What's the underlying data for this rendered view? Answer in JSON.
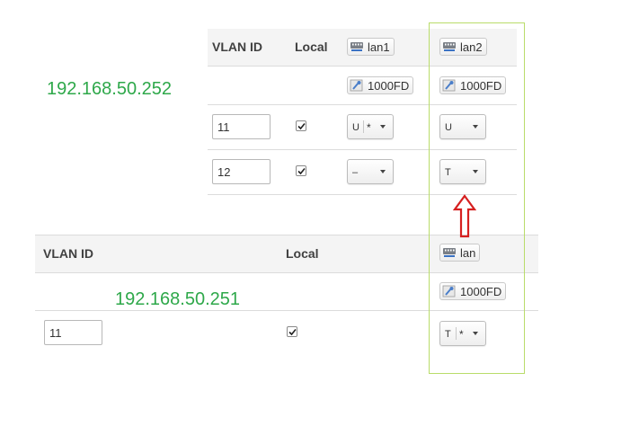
{
  "top_table": {
    "ip": "192.168.50.252",
    "header": {
      "vlan_id": "VLAN ID",
      "local": "Local"
    },
    "ports": [
      {
        "name": "lan1",
        "speed": "1000FD"
      },
      {
        "name": "lan2",
        "speed": "1000FD"
      }
    ],
    "rows": [
      {
        "vlan_id": "11",
        "local_checked": true,
        "lan1": {
          "mode": "U",
          "extra": "*"
        },
        "lan2": {
          "mode": "U",
          "extra": ""
        }
      },
      {
        "vlan_id": "12",
        "local_checked": true,
        "lan1": {
          "mode": "–",
          "extra": ""
        },
        "lan2": {
          "mode": "T",
          "extra": ""
        }
      }
    ]
  },
  "bottom_table": {
    "ip": "192.168.50.251",
    "header": {
      "vlan_id": "VLAN ID",
      "local": "Local"
    },
    "ports": [
      {
        "name": "lan",
        "speed": "1000FD"
      }
    ],
    "rows": [
      {
        "vlan_id": "11",
        "local_checked": true,
        "lan": {
          "mode": "T",
          "extra": "*"
        }
      }
    ]
  },
  "annotation": {
    "highlight_color": "#b9dc6a",
    "arrow_color": "#d62020",
    "ip_color": "#2ea84a"
  }
}
